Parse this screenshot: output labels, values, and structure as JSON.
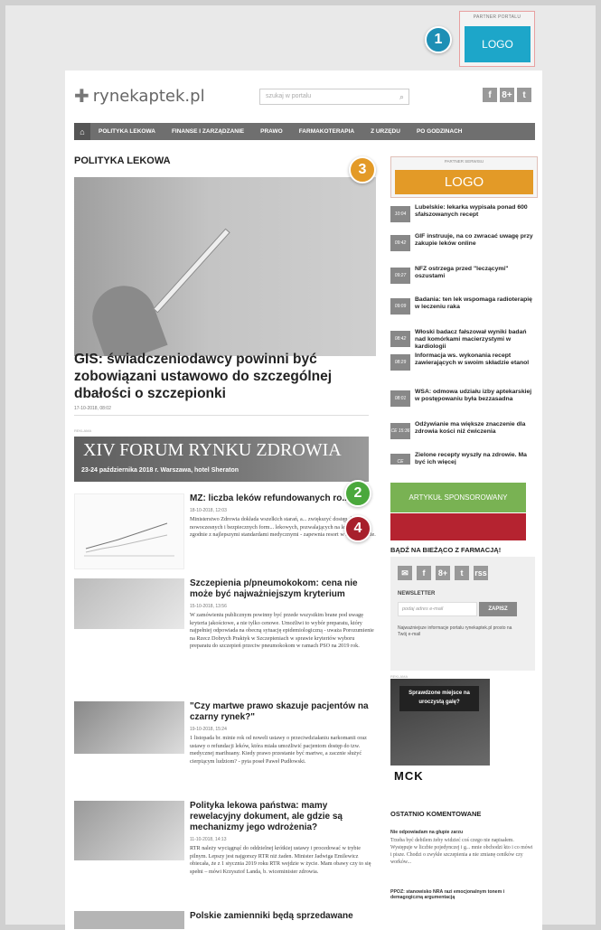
{
  "partner_top": {
    "label": "PARTNER PORTALU",
    "logo": "LOGO"
  },
  "badges": {
    "b1": "1",
    "b2": "2",
    "b3": "3",
    "b4": "4"
  },
  "site": {
    "name": "rynekaptek.pl",
    "search_placeholder": "szukaj w portalu"
  },
  "social": [
    "f",
    "8+",
    "t"
  ],
  "nav": [
    "POLITYKA LEKOWA",
    "FINANSE I ZARZĄDZANIE",
    "PRAWO",
    "FARMAKOTERAPIA",
    "Z URZĘDU",
    "PO GODZINACH"
  ],
  "section_title": "POLITYKA LEKOWA",
  "hero": {
    "headline": "GIS: świadczeniodawcy powinni być zobowiązani ustawowo do szczególnej dbałości o szczepionki",
    "date": "17-10-2018, 08:02"
  },
  "rek_label": "REKLAMA",
  "forum": {
    "title": "XIV FORUM RYNKU ZDROWIA",
    "subtitle": "23-24 października 2018 r.  Warszawa, hotel Sheraton"
  },
  "articles": [
    {
      "title": "MZ: liczba leków refundowanych ro...",
      "date": "18-10-2018, 12:03",
      "lead": "Ministerstwo Zdrowia dokłada wszelkich starań, a... zwiększyć dostęp do nowoczesnych i bezpiecznych form... lekowych, pozwalających na leczenie zgodnie z najlepszymi standardami medycznymi - zapewnia resort w komunikacie."
    },
    {
      "title": "Szczepienia p/pneumokokom: cena nie może być najważniejszym kryterium",
      "date": "15-10-2018, 13:56",
      "lead": "W zamówieniu publicznym powinny być przede wszystkim brane pod uwagę kryteria jakościowe, a nie tylko cenowe. Umożliwi to wybór preparatu, który najpełniej odpowiada na obecną sytuację epidemiologiczną - uważa Porozumienie na Rzecz Dobrych Praktyk w Szczepieniach w sprawie kryteriów wyboru preparatu do szczepień przeciw pneumokokom w ramach PSO na 2019 rok."
    },
    {
      "title": "\"Czy martwe prawo skazuje pacjentów na czarny rynek?\"",
      "date": "19-10-2018, 15:24",
      "lead": "1 listopada br. minie rok od noweli ustawy o przeciwdziałaniu narkomanii oraz ustawy o refundacji leków, która miała umożliwić pacjentom dostęp do tzw. medycznej marihuany. Kiedy prawo przestanie być martwe, a zacznie służyć cierpiącym ludziom? - pyta poseł Paweł Pudłowski."
    },
    {
      "title": "Polityka lekowa państwa: mamy rewelacyjny dokument, ale gdzie są mechanizmy jego wdrożenia?",
      "date": "11-10-2018, 14:13",
      "lead": "RTR należy wyciągnąć do oddzielnej krótkiej ustawy i procedować w trybie pilnym. Lepszy jest najgorszy RTR niż żaden. Minister Jadwiga Emilewicz obiecała, że z 1 stycznia 2019 roku RTR wejdzie w życie. Mam obawy czy to się spełni – mówi Krzysztof Landa, b. wiceminister zdrowia."
    },
    {
      "title": "Polskie zamienniki będą sprzedawane",
      "date": "",
      "lead": ""
    }
  ],
  "sidebar_ad": {
    "label": "PARTNER SERWISU",
    "logo": "LOGO"
  },
  "news": [
    {
      "time": "10:04",
      "text": "Lubelskie: lekarka wypisała ponad 600 sfałszowanych recept"
    },
    {
      "time": "09:42",
      "text": "GIF instruuje, na co zwracać uwagę przy zakupie leków online"
    },
    {
      "time": "09:27",
      "text": "NFZ ostrzega przed \"leczącymi\" oszustami"
    },
    {
      "time": "09:09",
      "text": "Badania: ten lek wspomaga radioterapię w leczeniu raka"
    },
    {
      "time": "08:42",
      "text": "Włoski badacz fałszował wyniki badań nad komórkami macierzystymi w kardiologii"
    },
    {
      "time": "08:29",
      "text": "Informacja ws. wykonania recept zawierających w swoim składzie etanol"
    },
    {
      "time": "08:01",
      "text": "WSA: odmowa udziału izby aptekarskiej w postępowaniu była bezzasadna"
    },
    {
      "time": "CE 15:36",
      "text": "Odżywianie ma większe znaczenie dla zdrowia kości niż ćwiczenia"
    },
    {
      "time": "CE",
      "text": "Zielone recepty wyszły na zdrowie. Ma być ich więcej"
    }
  ],
  "sponsored": "ARTYKUŁ SPONSOROWANY",
  "follow": {
    "heading": "BĄDŹ NA BIEŻĄCO Z FARMACJĄ!",
    "icons": [
      "✉",
      "f",
      "8+",
      "t",
      "rss"
    ],
    "newsletter": "NEWSLETTER",
    "email_placeholder": "podaj adres e-mail",
    "button": "ZAPISZ",
    "note": "Najważniejsze informacje portalu rynekaptek.pl prosto na Twój e-mail"
  },
  "mck": {
    "banner": "Sprawdzone miejsce na uroczystą galę?",
    "brand": "MCK"
  },
  "comments": {
    "heading": "OSTATNIO KOMENTOWANE",
    "items": [
      {
        "title": "Nie odpowiadam na głupie zarzu",
        "body": "Trzeba być debilem żeby widzieć coś czego nie napisałem. Występuje w liczbie pojedynczej i g... mnie obchodzi kto i co mówi i pisze. Chodzi o zwykłe szczepienia a nie zmianę ceników czy worków..."
      },
      {
        "title": "PPOZ: stanowisko NRA razi emocjonalnym tonem i demagogiczną argumentacją",
        "body": ""
      }
    ]
  }
}
